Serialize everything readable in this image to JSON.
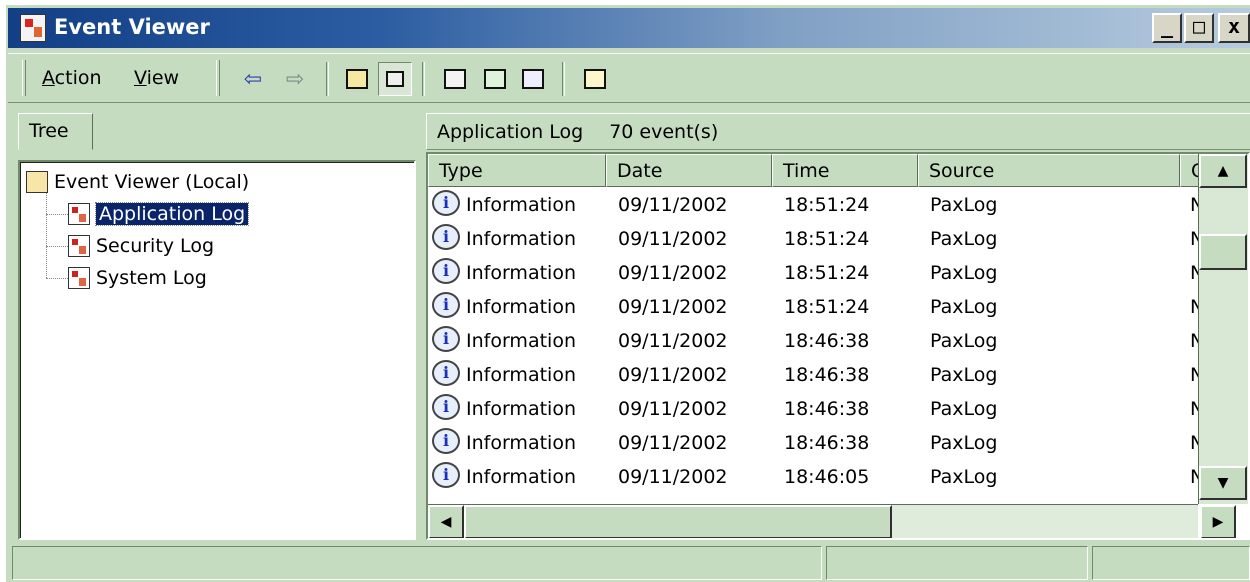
{
  "window": {
    "title": "Event Viewer",
    "buttons": {
      "minimize": "_",
      "maximize": "□",
      "close": "x"
    }
  },
  "toolbar": {
    "menu": [
      {
        "label": "Action",
        "accel": "A",
        "rest": "ction"
      },
      {
        "label": "View",
        "accel": "V",
        "rest": "iew"
      }
    ],
    "icons": [
      "back-arrow-icon",
      "forward-arrow-icon",
      "up-one-level-icon",
      "show-hide-tree-icon",
      "properties-icon",
      "refresh-icon",
      "export-list-icon",
      "help-icon"
    ]
  },
  "tree": {
    "tab_label": "Tree",
    "root": "Event Viewer (Local)",
    "children": [
      {
        "label": "Application Log",
        "selected": true
      },
      {
        "label": "Security Log",
        "selected": false
      },
      {
        "label": "System Log",
        "selected": false
      }
    ]
  },
  "list": {
    "header_title": "Application Log",
    "header_count": "70 event(s)",
    "columns": [
      "Type",
      "Date",
      "Time",
      "Source",
      "Ca"
    ],
    "rows": [
      {
        "type": "Information",
        "date": "09/11/2002",
        "time": "18:51:24",
        "source": "PaxLog",
        "category": "No"
      },
      {
        "type": "Information",
        "date": "09/11/2002",
        "time": "18:51:24",
        "source": "PaxLog",
        "category": "No"
      },
      {
        "type": "Information",
        "date": "09/11/2002",
        "time": "18:51:24",
        "source": "PaxLog",
        "category": "No"
      },
      {
        "type": "Information",
        "date": "09/11/2002",
        "time": "18:51:24",
        "source": "PaxLog",
        "category": "No"
      },
      {
        "type": "Information",
        "date": "09/11/2002",
        "time": "18:46:38",
        "source": "PaxLog",
        "category": "No"
      },
      {
        "type": "Information",
        "date": "09/11/2002",
        "time": "18:46:38",
        "source": "PaxLog",
        "category": "No"
      },
      {
        "type": "Information",
        "date": "09/11/2002",
        "time": "18:46:38",
        "source": "PaxLog",
        "category": "No"
      },
      {
        "type": "Information",
        "date": "09/11/2002",
        "time": "18:46:38",
        "source": "PaxLog",
        "category": "No"
      },
      {
        "type": "Information",
        "date": "09/11/2002",
        "time": "18:46:05",
        "source": "PaxLog",
        "category": "No"
      }
    ]
  },
  "colors": {
    "title_start": "#123f85",
    "title_end": "#b6cbde",
    "chrome": "#c6dcc1",
    "selection": "#0a246a"
  }
}
